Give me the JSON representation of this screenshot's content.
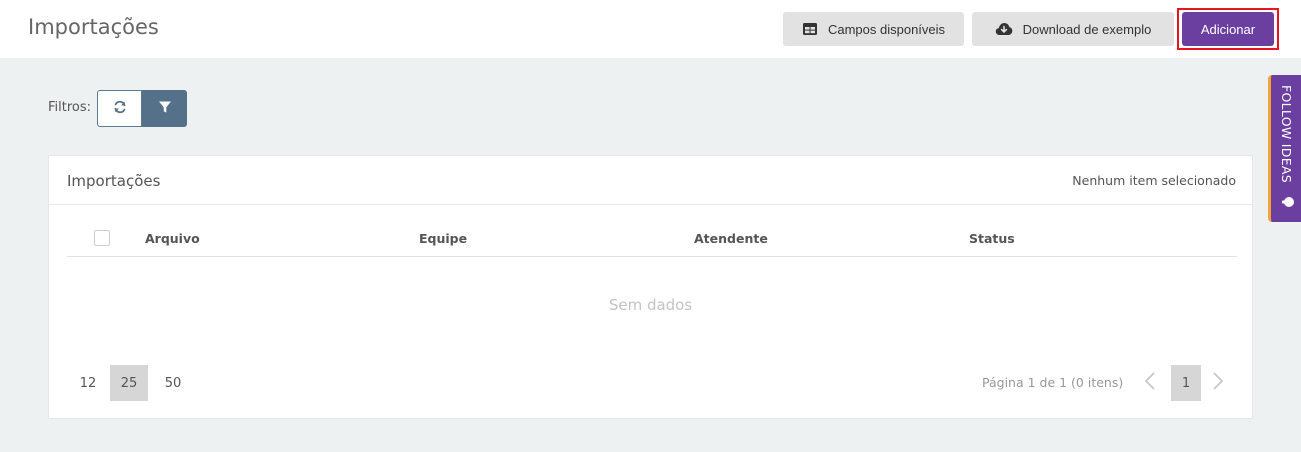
{
  "header": {
    "title": "Importações",
    "campos_label": "Campos disponíveis",
    "download_label": "Download de exemplo",
    "add_label": "Adicionar"
  },
  "filters": {
    "label": "Filtros:"
  },
  "card": {
    "title": "Importações",
    "selection_status": "Nenhum item selecionado",
    "columns": [
      "Arquivo",
      "Equipe",
      "Atendente",
      "Status"
    ],
    "empty_text": "Sem dados"
  },
  "pagination": {
    "page_sizes": [
      "12",
      "25",
      "50"
    ],
    "selected_page_size": "25",
    "info": "Página 1 de 1 (0 itens)",
    "current_page": "1"
  },
  "side_tab": {
    "label": "FOLLOW IDEAS"
  },
  "colors": {
    "accent": "#6b3fa0",
    "highlight_border": "#e8141e",
    "filter_button": "#55718a",
    "side_tab_stripe": "#f0a535"
  },
  "icons": {
    "campos": "table-icon",
    "download": "cloud-download-icon",
    "refresh": "refresh-icon",
    "filter": "filter-icon",
    "prev": "chevron-left-icon",
    "next": "chevron-right-icon",
    "follow": "lightbulb-icon"
  }
}
